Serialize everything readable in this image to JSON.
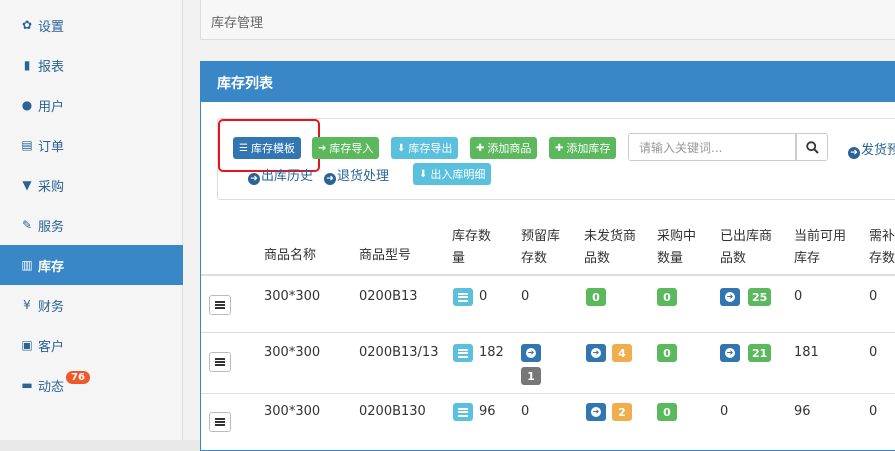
{
  "sidebar": {
    "items": [
      {
        "icon": "gear-icon",
        "glyph": "✿",
        "label": "设置"
      },
      {
        "icon": "bar-chart-icon",
        "glyph": "▮",
        "label": "报表"
      },
      {
        "icon": "user-icon",
        "glyph": "●",
        "label": "用户"
      },
      {
        "icon": "list-icon",
        "glyph": "▤",
        "label": "订单"
      },
      {
        "icon": "cart-icon",
        "glyph": "▼",
        "label": "采购"
      },
      {
        "icon": "wrench-icon",
        "glyph": "✎",
        "label": "服务"
      },
      {
        "icon": "barcode-icon",
        "glyph": "▥",
        "label": "库存"
      },
      {
        "icon": "yen-icon",
        "glyph": "¥",
        "label": "财务"
      },
      {
        "icon": "briefcase-icon",
        "glyph": "▣",
        "label": "客户"
      },
      {
        "icon": "comment-icon",
        "glyph": "▬",
        "label": "动态",
        "badge": "76"
      }
    ],
    "active_index": 6
  },
  "breadcrumb": "库存管理",
  "panel": {
    "title": "库存列表",
    "buttons": {
      "template": "库存模板",
      "import": "库存导入",
      "export": "库存导出",
      "add_product": "添加商品",
      "add_stock": "添加库存",
      "detail": "出入库明细"
    },
    "search_placeholder": "请输入关键词...",
    "links": {
      "ship": "发货预",
      "out_history": "出库历史",
      "returns": "退货处理"
    }
  },
  "table": {
    "headers": {
      "name": "商品名称",
      "model": "商品型号",
      "stock_1": "库存数",
      "stock_2": "量",
      "reserved_1": "预留库",
      "reserved_2": "存数",
      "unshipped_1": "未发货商",
      "unshipped_2": "品数",
      "purchasing_1": "采购中",
      "purchasing_2": "数量",
      "shipped_1": "已出库商",
      "shipped_2": "品数",
      "available_1": "当前可用",
      "available_2": "库存",
      "need_1": "需补",
      "need_2": "存数"
    },
    "rows": [
      {
        "name": "300*300",
        "model": "0200B13",
        "stock": "0",
        "reserved": "0",
        "reserved_tag": "",
        "unshipped_tag": "0",
        "unshipped_count": "",
        "purchasing": "0",
        "shipped": "",
        "shipped_count": "25",
        "available": "0",
        "need": "0"
      },
      {
        "name": "300*300",
        "model": "0200B13/13",
        "stock": "182",
        "reserved": "",
        "reserved_tag": "1",
        "unshipped_tag": "",
        "unshipped_count": "4",
        "purchasing": "0",
        "shipped": "",
        "shipped_count": "21",
        "available": "181",
        "need": "0"
      },
      {
        "name": "300*300",
        "model": "0200B130",
        "stock": "96",
        "reserved": "0",
        "reserved_tag": "",
        "unshipped_tag": "",
        "unshipped_count": "2",
        "purchasing": "0",
        "shipped": "0",
        "shipped_count": "",
        "available": "96",
        "need": "0"
      }
    ]
  },
  "colors": {
    "primary": "#3a87c8",
    "green": "#5cb85c",
    "cyan": "#5bc0de",
    "orange": "#f0ad4e",
    "badge_red": "#f0572a",
    "highlight": "#e8141b"
  }
}
